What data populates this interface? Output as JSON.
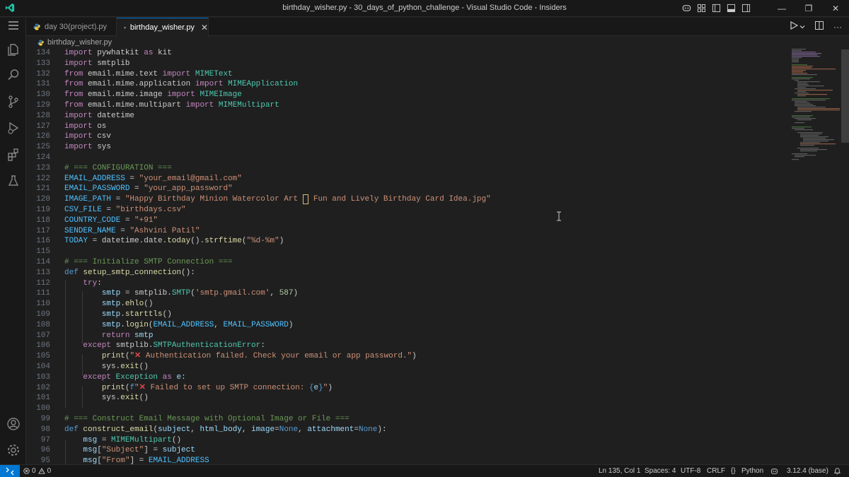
{
  "window": {
    "title": "birthday_wisher.py - 30_days_of_python_challenge - Visual Studio Code - Insiders",
    "controls": [
      "—",
      "❐",
      "✕"
    ]
  },
  "tabs": [
    {
      "label": "day 30(project).py",
      "active": false
    },
    {
      "label": "birthday_wisher.py",
      "active": true,
      "close": "✕"
    }
  ],
  "breadcrumb": {
    "file": "birthday_wisher.py"
  },
  "code": {
    "lines": [
      {
        "n": "134",
        "html": "<span class=\"kw\">import</span> pywhatkit <span class=\"kw\">as</span> kit"
      },
      {
        "n": "133",
        "html": "<span class=\"kw\">import</span> smtplib"
      },
      {
        "n": "132",
        "html": "<span class=\"kw\">from</span> email.mime.text <span class=\"kw\">import</span> <span class=\"cls\">MIMEText</span>"
      },
      {
        "n": "131",
        "html": "<span class=\"kw\">from</span> email.mime.application <span class=\"kw\">import</span> <span class=\"cls\">MIMEApplication</span>"
      },
      {
        "n": "130",
        "html": "<span class=\"kw\">from</span> email.mime.image <span class=\"kw\">import</span> <span class=\"cls\">MIMEImage</span>"
      },
      {
        "n": "129",
        "html": "<span class=\"kw\">from</span> email.mime.multipart <span class=\"kw\">import</span> <span class=\"cls\">MIMEMultipart</span>"
      },
      {
        "n": "128",
        "html": "<span class=\"kw\">import</span> datetime"
      },
      {
        "n": "127",
        "html": "<span class=\"kw\">import</span> os"
      },
      {
        "n": "126",
        "html": "<span class=\"kw\">import</span> csv"
      },
      {
        "n": "125",
        "html": "<span class=\"kw\">import</span> sys"
      },
      {
        "n": "124",
        "html": ""
      },
      {
        "n": "123",
        "html": "<span class=\"com\"># === CONFIGURATION ===</span>"
      },
      {
        "n": "122",
        "html": "<span class=\"const\">EMAIL_ADDRESS</span> = <span class=\"str\">\"your_email@gmail.com\"</span>"
      },
      {
        "n": "121",
        "html": "<span class=\"const\">EMAIL_PASSWORD</span> = <span class=\"str\">\"your_app_password\"</span>"
      },
      {
        "n": "120",
        "html": "<span class=\"const\">IMAGE_PATH</span> = <span class=\"str\">\"Happy Birthday Minion Watercolor Art <span style=\"border:1px solid #d7ba7d\">&nbsp;</span> Fun and Lively Birthday Card Idea.jpg\"</span>"
      },
      {
        "n": "119",
        "html": "<span class=\"const\">CSV_FILE</span> = <span class=\"str\">\"birthdays.csv\"</span>"
      },
      {
        "n": "118",
        "html": "<span class=\"const\">COUNTRY_CODE</span> = <span class=\"str\">\"+91\"</span>"
      },
      {
        "n": "117",
        "html": "<span class=\"const\">SENDER_NAME</span> = <span class=\"str\">\"Ashvini Patil\"</span>"
      },
      {
        "n": "116",
        "html": "<span class=\"const\">TODAY</span> = datetime.date.<span class=\"fn\">today</span>().<span class=\"fn\">strftime</span>(<span class=\"str\">\"%d-%m\"</span>)"
      },
      {
        "n": "115",
        "html": ""
      },
      {
        "n": "114",
        "html": "<span class=\"com\"># === Initialize SMTP Connection ===</span>"
      },
      {
        "n": "113",
        "html": "<span class=\"kw2\">def</span> <span class=\"fn\">setup_smtp_connection</span>():"
      },
      {
        "n": "112",
        "html": "    <span class=\"kw\">try</span>:"
      },
      {
        "n": "111",
        "html": "        <span class=\"var\">smtp</span> = smtplib.<span class=\"cls\">SMTP</span>(<span class=\"str\">'smtp.gmail.com'</span>, <span class=\"num\">587</span>)"
      },
      {
        "n": "110",
        "html": "        <span class=\"var\">smtp</span>.<span class=\"fn\">ehlo</span>()"
      },
      {
        "n": "109",
        "html": "        <span class=\"var\">smtp</span>.<span class=\"fn\">starttls</span>()"
      },
      {
        "n": "108",
        "html": "        <span class=\"var\">smtp</span>.<span class=\"fn\">login</span>(<span class=\"const\">EMAIL_ADDRESS</span>, <span class=\"const\">EMAIL_PASSWORD</span>)"
      },
      {
        "n": "107",
        "html": "        <span class=\"kw\">return</span> <span class=\"var\">smtp</span>"
      },
      {
        "n": "106",
        "html": "    <span class=\"kw\">except</span> smtplib.<span class=\"cls\">SMTPAuthenticationError</span>:"
      },
      {
        "n": "105",
        "html": "        <span class=\"fn\">print</span>(<span class=\"str\">\"<span class=\"x-mark\">✕</span> Authentication failed. Check your email or app password.\"</span>)"
      },
      {
        "n": "104",
        "html": "        sys.<span class=\"fn\">exit</span>()"
      },
      {
        "n": "103",
        "html": "    <span class=\"kw\">except</span> <span class=\"cls\">Exception</span> <span class=\"kw\">as</span> <span class=\"var\">e</span>:"
      },
      {
        "n": "102",
        "html": "        <span class=\"fn\">print</span>(<span class=\"kw2\">f</span><span class=\"str\">\"<span class=\"x-mark\">✕</span> Failed to set up SMTP connection: </span><span class=\"kw2\">{</span><span class=\"var\">e</span><span class=\"kw2\">}</span><span class=\"str\">\"</span>)"
      },
      {
        "n": "101",
        "html": "        sys.<span class=\"fn\">exit</span>()"
      },
      {
        "n": "100",
        "html": ""
      },
      {
        "n": "99",
        "html": "<span class=\"com\"># === Construct Email Message with Optional Image or File ===</span>"
      },
      {
        "n": "98",
        "html": "<span class=\"kw2\">def</span> <span class=\"fn\">construct_email</span>(<span class=\"var\">subject</span>, <span class=\"var\">html_body</span>, <span class=\"var\">image</span>=<span class=\"kw2\">None</span>, <span class=\"var\">attachment</span>=<span class=\"kw2\">None</span>):"
      },
      {
        "n": "97",
        "html": "    <span class=\"var\">msg</span> = <span class=\"cls\">MIMEMultipart</span>()"
      },
      {
        "n": "96",
        "html": "    <span class=\"var\">msg</span>[<span class=\"str\">\"Subject\"</span>] = <span class=\"var\">subject</span>"
      },
      {
        "n": "95",
        "html": "    <span class=\"var\">msg</span>[<span class=\"str\">\"From\"</span>] = <span class=\"const\">EMAIL_ADDRESS</span>"
      }
    ]
  },
  "statusbar": {
    "errors": "0",
    "warnings": "0",
    "position": "Ln 135, Col 1",
    "spaces": "Spaces: 4",
    "encoding": "UTF-8",
    "eol": "CRLF",
    "language": "Python",
    "interpreter": "3.12.4 (base)"
  },
  "colors": {
    "accent": "#0078d4",
    "background": "#1f1f1f",
    "chrome": "#181818"
  }
}
